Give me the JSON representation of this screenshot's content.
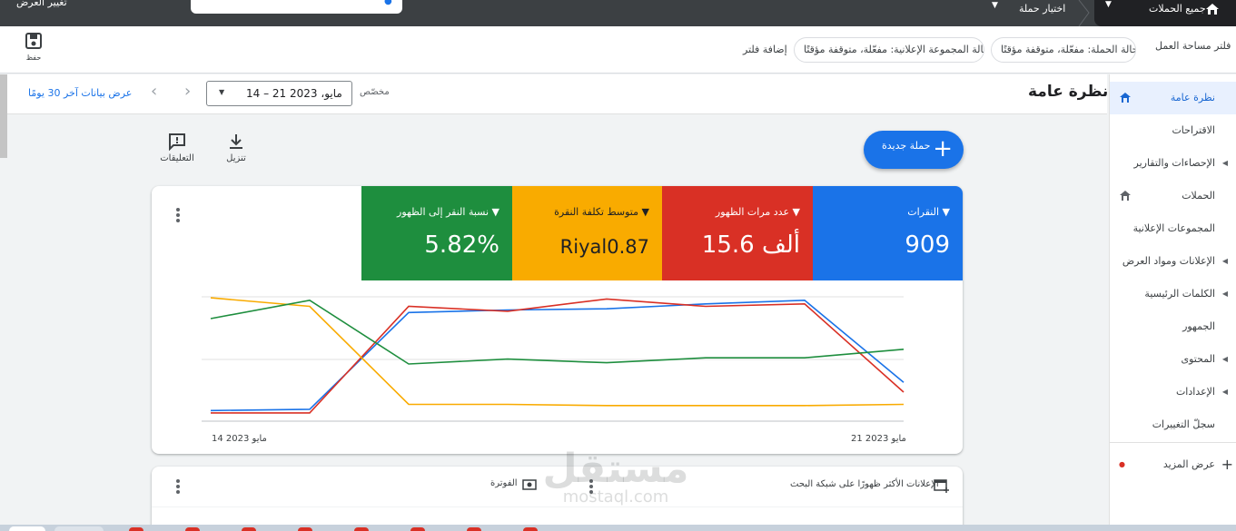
{
  "topbar": {
    "change_view": "تغيير العرض",
    "all_campaigns": "جميع الحملات",
    "select_campaign": "اختيار حملة"
  },
  "filters": {
    "workspace_filter": "فلتر مساحة العمل",
    "campaign_status": "حالة الحملة: مفعّلة، متوقفة مؤقتًا",
    "adgroup_status": "حالة المجموعة الإعلانية: مفعّلة، متوقفة مؤقتًا",
    "extra_chip": "مفعّلة، متوقفة مؤقتًا",
    "add_filter": "إضافة فلتر",
    "save": "حفظ"
  },
  "header": {
    "page_title": "نظرة عامة",
    "custom_label": "مخصّص",
    "date_range": "14 – 21 مايو، 2023",
    "show_last_30": "عرض بيانات آخر 30 يومًا"
  },
  "sidebar": {
    "items": [
      {
        "label": "نظرة عامة",
        "icon": "home-icon",
        "active": true
      },
      {
        "label": "الاقتراحات"
      },
      {
        "label": "الإحصاءات والتقارير",
        "expand": true
      },
      {
        "label": "الحملات",
        "icon": "home-icon"
      },
      {
        "label": "المجموعات الإعلانية"
      },
      {
        "label": "الإعلانات ومواد العرض",
        "expand": true
      },
      {
        "label": "الكلمات الرئيسية",
        "expand": true
      },
      {
        "label": "الجمهور"
      },
      {
        "label": "المحتوى",
        "expand": true
      },
      {
        "label": "الإعدادات",
        "expand": true
      },
      {
        "label": "سجلّ التغييرات"
      }
    ],
    "show_more": "عرض المزيد"
  },
  "toolbar": {
    "new_campaign": "حملة جديدة",
    "download": "تنزيل",
    "feedback": "التعليقات"
  },
  "metrics": [
    {
      "label": "النقرات",
      "value": "909",
      "color": "#1a73e8"
    },
    {
      "label": "عدد مرات الظهور",
      "value": "15.6 ألف",
      "color": "#d93025"
    },
    {
      "label": "متوسط تكلفة النقرة",
      "value": "Riyal0.87",
      "color": "#f9ab00"
    },
    {
      "label": "نسبة النقر إلى الظهور",
      "value": "5.82%",
      "color": "#1e8e3e"
    }
  ],
  "chart_data": {
    "type": "line",
    "x_start_label": "14 مايو 2023",
    "x_end_label": "21 مايو 2023",
    "x": [
      14,
      15,
      16,
      17,
      18,
      19,
      20,
      21
    ],
    "series": [
      {
        "name": "النقرات",
        "color": "#1a73e8",
        "values": [
          0.05,
          0.06,
          0.85,
          0.87,
          0.88,
          0.92,
          0.95,
          0.28
        ]
      },
      {
        "name": "عدد مرات الظهور",
        "color": "#d93025",
        "values": [
          0.03,
          0.03,
          0.9,
          0.86,
          0.96,
          0.9,
          0.92,
          0.2
        ]
      },
      {
        "name": "متوسط تكلفة النقرة",
        "color": "#f9ab00",
        "values": [
          0.97,
          0.9,
          0.1,
          0.1,
          0.09,
          0.09,
          0.09,
          0.1
        ]
      },
      {
        "name": "نسبة النقر إلى الظهور",
        "color": "#1e8e3e",
        "values": [
          0.8,
          0.95,
          0.43,
          0.47,
          0.44,
          0.48,
          0.48,
          0.55
        ]
      }
    ]
  },
  "bottom_cards": {
    "billing": "الفوترة",
    "top_ads": "الإعلانات الأكثر ظهورًا على شبكة البحث"
  },
  "watermark": {
    "ar": "مستقل",
    "en": "mostaql.com"
  }
}
